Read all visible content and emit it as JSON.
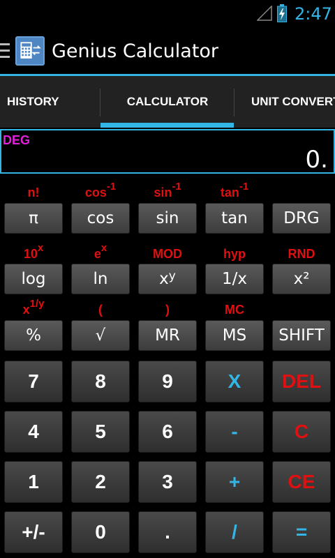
{
  "status": {
    "time": "2:47"
  },
  "app": {
    "title": "Genius Calculator"
  },
  "tabs": {
    "history": "HISTORY",
    "calculator": "CALCULATOR",
    "unit": "UNIT CONVERT"
  },
  "display": {
    "mode": "DEG",
    "value": "0."
  },
  "secondary_labels": {
    "r1": [
      "n!",
      "cos",
      "sin",
      "tan",
      ""
    ],
    "r1_sup": [
      "",
      "-1",
      "-1",
      "-1",
      ""
    ],
    "r2": [
      "10",
      "e",
      "MOD",
      "hyp",
      "RND"
    ],
    "r2_sup": [
      "x",
      "x",
      "",
      "",
      ""
    ],
    "r3": [
      "x",
      "(",
      ")",
      "MC",
      ""
    ],
    "r3_sup": [
      "1/y",
      "",
      "",
      "",
      ""
    ]
  },
  "function_keys": {
    "r1": [
      "π",
      "cos",
      "sin",
      "tan",
      "DRG"
    ],
    "r2": [
      "log",
      "ln",
      "x",
      "1/x",
      "x²"
    ],
    "r2_sup": [
      "",
      "",
      "y",
      "",
      ""
    ],
    "r3": [
      "%",
      "√",
      "MR",
      "MS",
      "SHIFT"
    ]
  },
  "keypad": {
    "r1": [
      "7",
      "8",
      "9",
      "X",
      "DEL"
    ],
    "r2": [
      "4",
      "5",
      "6",
      "-",
      "C"
    ],
    "r3": [
      "1",
      "2",
      "3",
      "+",
      "CE"
    ],
    "r4": [
      "+/-",
      "0",
      ".",
      "/",
      "="
    ]
  },
  "colors": {
    "accent": "#33b5e5",
    "secondary_label": "#e01010",
    "mode": "#e020d8"
  },
  "icons": {
    "signal": "signal-icon",
    "battery": "battery-charging-icon",
    "menu": "hamburger-icon",
    "app": "calculator-app-icon"
  }
}
